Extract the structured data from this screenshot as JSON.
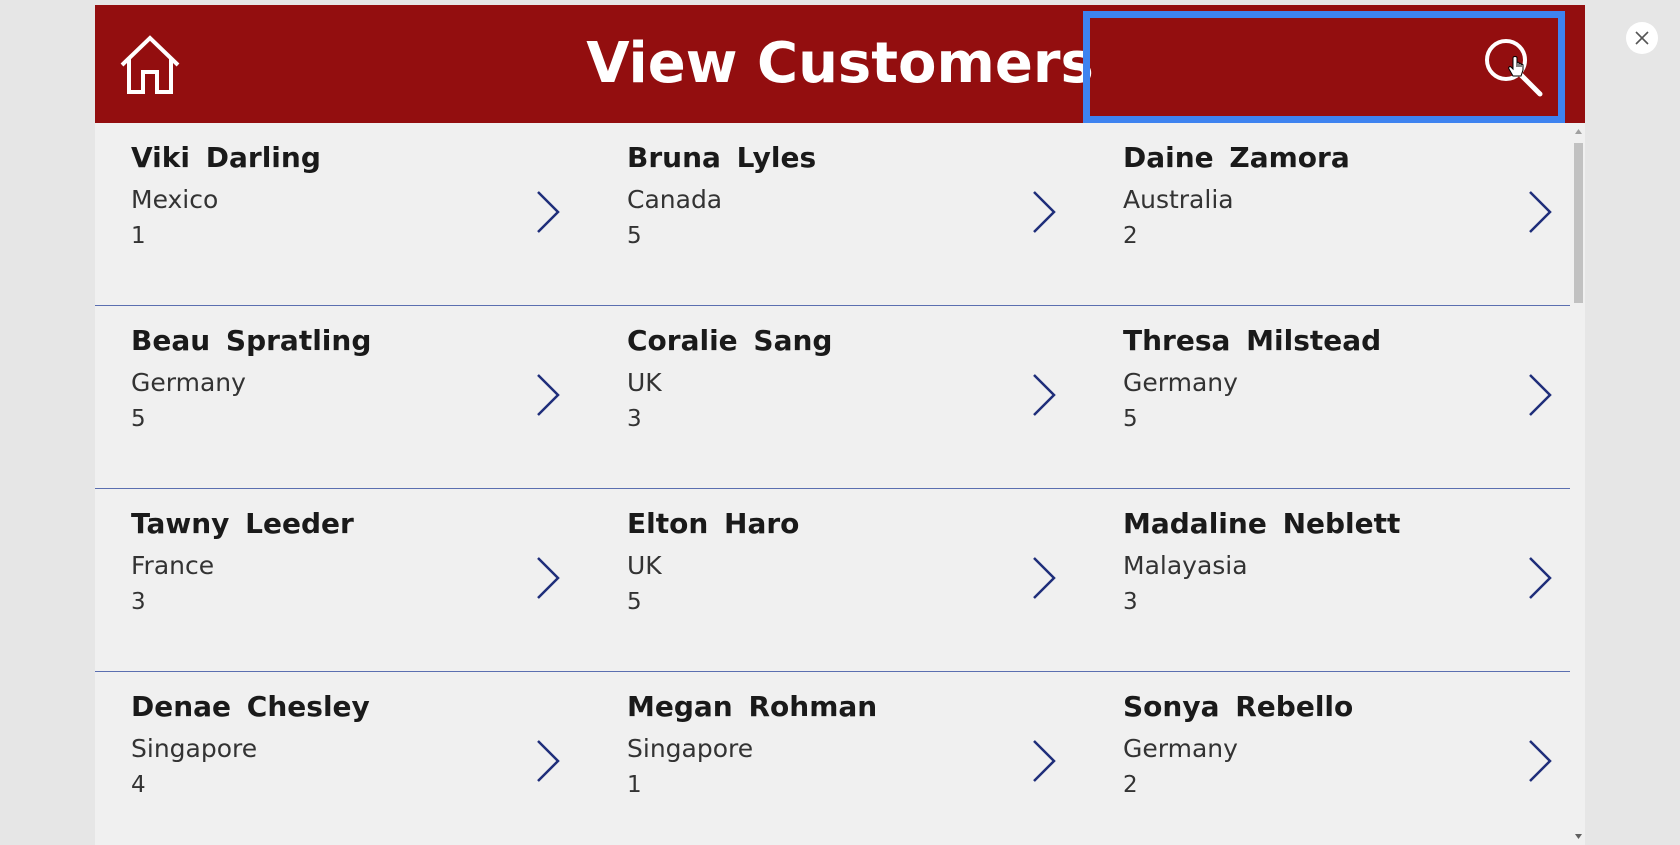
{
  "header": {
    "title": "View Customers",
    "background": "#930e0f",
    "home_icon": "home-icon",
    "search_icon": "search-icon",
    "search_value": ""
  },
  "customers": [
    [
      {
        "name": "Viki  Darling",
        "country": "Mexico",
        "count": "1"
      },
      {
        "name": "Bruna  Lyles",
        "country": "Canada",
        "count": "5"
      },
      {
        "name": "Daine  Zamora",
        "country": "Australia",
        "count": "2"
      }
    ],
    [
      {
        "name": "Beau  Spratling",
        "country": "Germany",
        "count": "5"
      },
      {
        "name": "Coralie  Sang",
        "country": "UK",
        "count": "3"
      },
      {
        "name": "Thresa  Milstead",
        "country": "Germany",
        "count": "5"
      }
    ],
    [
      {
        "name": "Tawny  Leeder",
        "country": "France",
        "count": "3"
      },
      {
        "name": "Elton  Haro",
        "country": "UK",
        "count": "5"
      },
      {
        "name": "Madaline  Neblett",
        "country": "Malayasia",
        "count": "3"
      }
    ],
    [
      {
        "name": "Denae  Chesley",
        "country": "Singapore",
        "count": "4"
      },
      {
        "name": "Megan  Rohman",
        "country": "Singapore",
        "count": "1"
      },
      {
        "name": "Sonya  Rebello",
        "country": "Germany",
        "count": "2"
      }
    ]
  ],
  "colors": {
    "accent": "#930e0f",
    "selection": "#3e83f0",
    "chevron": "#1f2e7a",
    "divider": "#5b6fb0"
  }
}
